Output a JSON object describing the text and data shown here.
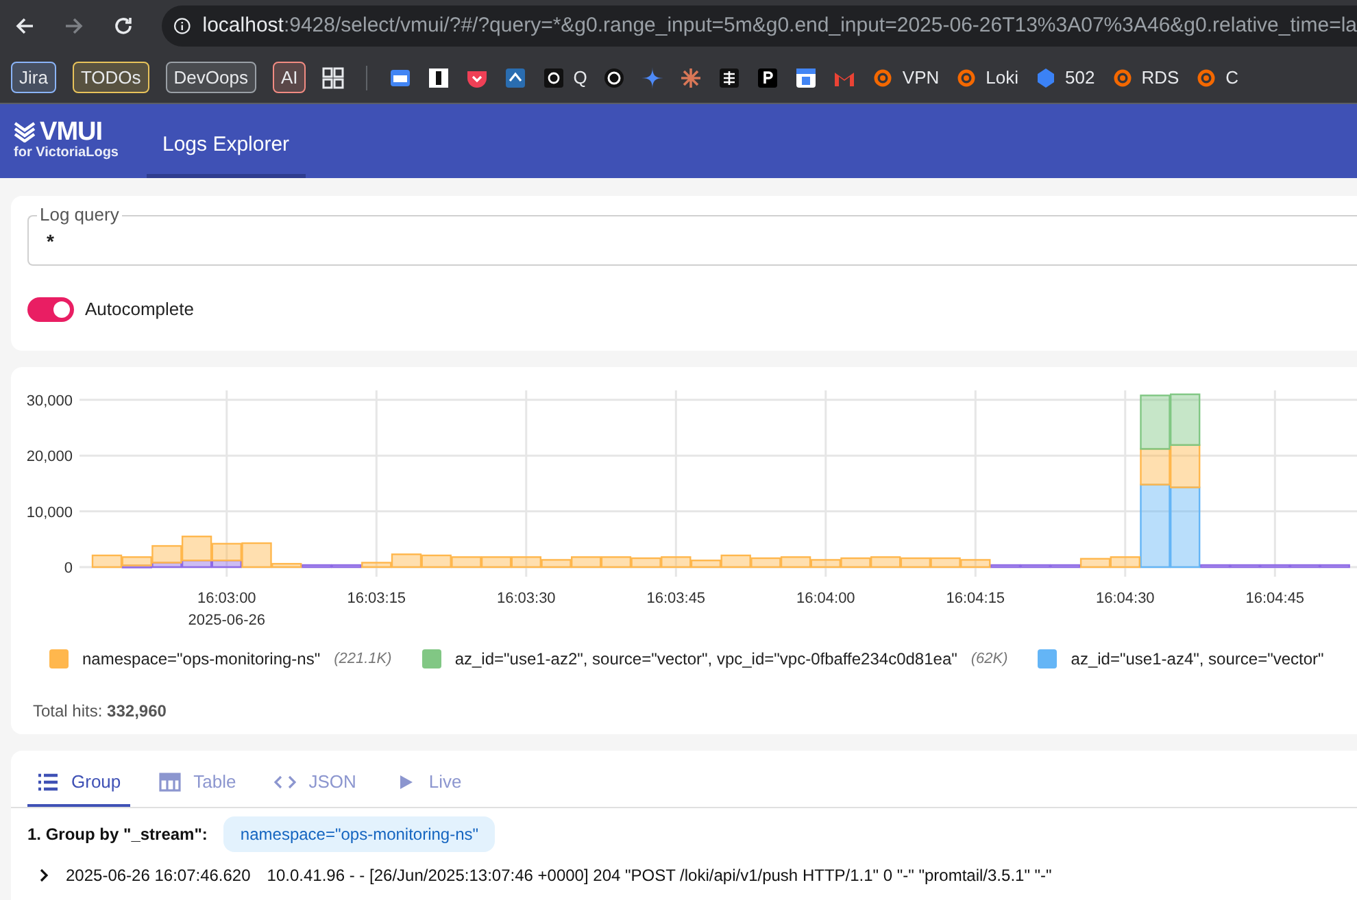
{
  "browser": {
    "url_host": "localhost",
    "url_path": ":9428/select/vmui/?#/?query=*&g0.range_input=5m&g0.end_input=2025-06-26T13%3A07%3A46&g0.relative_time=la",
    "bookmarks": [
      {
        "kind": "tag",
        "label": "Jira",
        "color": "#8ab4f8"
      },
      {
        "kind": "tag",
        "label": "TODOs",
        "color": "#e8c35a"
      },
      {
        "kind": "tag",
        "label": "DevOops",
        "color": "#9aa0a6"
      },
      {
        "kind": "tag",
        "label": "AI",
        "color": "#f28b82"
      },
      {
        "kind": "icon"
      },
      {
        "kind": "icon"
      },
      {
        "kind": "icon"
      },
      {
        "kind": "icon"
      },
      {
        "kind": "icon"
      },
      {
        "kind": "icon",
        "label": "Q"
      },
      {
        "kind": "icon"
      },
      {
        "kind": "icon"
      },
      {
        "kind": "icon"
      },
      {
        "kind": "icon"
      },
      {
        "kind": "icon"
      },
      {
        "kind": "icon"
      },
      {
        "kind": "icon"
      },
      {
        "kind": "icon",
        "label": "VPN"
      },
      {
        "kind": "icon",
        "label": "Loki"
      },
      {
        "kind": "icon",
        "label": "502"
      },
      {
        "kind": "icon",
        "label": "RDS"
      },
      {
        "kind": "icon",
        "label": "C"
      }
    ]
  },
  "header": {
    "logo": "VMUI",
    "logo_sub": "for VictoriaLogs",
    "tabs": [
      {
        "label": "Logs Explorer",
        "selected": true
      }
    ]
  },
  "query": {
    "label": "Log query",
    "value": "*",
    "autocomplete": {
      "label": "Autocomplete",
      "on": true
    }
  },
  "hits": {
    "chart_data": {
      "type": "bar",
      "stacked": true,
      "grid": true,
      "categories": [
        null,
        null,
        null,
        null,
        "16:03:00",
        null,
        null,
        null,
        null,
        "16:03:15",
        null,
        null,
        null,
        null,
        "16:03:30",
        null,
        null,
        null,
        null,
        "16:03:45",
        null,
        null,
        null,
        null,
        "16:04:00",
        null,
        null,
        null,
        null,
        "16:04:15",
        null,
        null,
        null,
        null,
        "16:04:30",
        null,
        null,
        null,
        null,
        "16:04:45",
        null,
        null
      ],
      "series": [
        {
          "color": "#8e6ae6",
          "values": [
            0,
            300,
            800,
            1200,
            1200,
            0,
            0,
            0,
            0,
            0,
            0,
            0,
            0,
            0,
            0,
            0,
            0,
            0,
            0,
            0,
            0,
            0,
            0,
            0,
            0,
            0,
            0,
            0,
            0,
            0,
            0,
            0,
            0,
            0,
            0,
            0,
            0,
            0,
            0,
            0,
            0,
            0
          ]
        },
        {
          "color": "#64b5f6",
          "values": [
            0,
            0,
            0,
            0,
            0,
            0,
            0,
            0,
            0,
            0,
            0,
            0,
            0,
            0,
            0,
            0,
            0,
            0,
            0,
            0,
            0,
            0,
            0,
            0,
            0,
            0,
            0,
            0,
            0,
            0,
            0,
            0,
            0,
            0,
            0,
            14800,
            14300,
            0,
            0,
            0,
            0,
            0
          ]
        },
        {
          "color": "#ffb74d",
          "values": [
            2100,
            1500,
            3000,
            4300,
            3000,
            4300,
            600,
            0,
            0,
            800,
            2300,
            2100,
            1800,
            1800,
            1800,
            1300,
            1800,
            1800,
            1600,
            1800,
            1200,
            2100,
            1600,
            1800,
            1300,
            1600,
            1800,
            1600,
            1600,
            1300,
            0,
            0,
            0,
            1500,
            1800,
            6400,
            7600,
            0,
            0,
            0,
            0,
            0
          ]
        },
        {
          "color": "#81c784",
          "values": [
            0,
            0,
            0,
            0,
            0,
            0,
            0,
            0,
            0,
            0,
            0,
            0,
            0,
            0,
            0,
            0,
            0,
            0,
            0,
            0,
            0,
            0,
            0,
            0,
            0,
            0,
            0,
            0,
            0,
            0,
            0,
            0,
            0,
            0,
            0,
            9600,
            9100,
            0,
            0,
            0,
            0,
            0
          ]
        }
      ],
      "ylim": [
        0,
        31700
      ],
      "yticks": [
        {
          "value": 0,
          "label": "0"
        },
        {
          "value": 10000,
          "label": "10,000"
        },
        {
          "value": 20000,
          "label": "20,000"
        },
        {
          "value": 30000,
          "label": "30,000"
        }
      ],
      "annotations": [
        "2025-06-26"
      ]
    },
    "legend": [
      {
        "label": "namespace=\"ops-monitoring-ns\"",
        "count": "(221.1K)",
        "color": "#ffb74d"
      },
      {
        "label": "az_id=\"use1-az2\", source=\"vector\", vpc_id=\"vpc-0fbaffe234c0d81ea\"",
        "count": "(62K)",
        "color": "#81c784"
      },
      {
        "label": "az_id=\"use1-az4\", source=\"vector\"",
        "color": "#64b5f6"
      }
    ],
    "total_label": "Total hits:",
    "total": "332,960"
  },
  "results": {
    "tabs": [
      {
        "label": "Group",
        "selected": true
      },
      {
        "label": "Table",
        "selected": false
      },
      {
        "label": "JSON",
        "selected": false
      },
      {
        "label": "Live",
        "selected": false
      }
    ],
    "group": {
      "title": "1. Group by \"_stream\":",
      "chip": "namespace=\"ops-monitoring-ns\"",
      "rows": [
        {
          "time": "2025-06-26 16:07:46.620",
          "message": "10.0.41.96 - - [26/Jun/2025:13:07:46 +0000] 204 \"POST /loki/api/v1/push HTTP/1.1\" 0 \"-\" \"promtail/3.5.1\" \"-\"",
          "expanded": false
        }
      ]
    }
  }
}
